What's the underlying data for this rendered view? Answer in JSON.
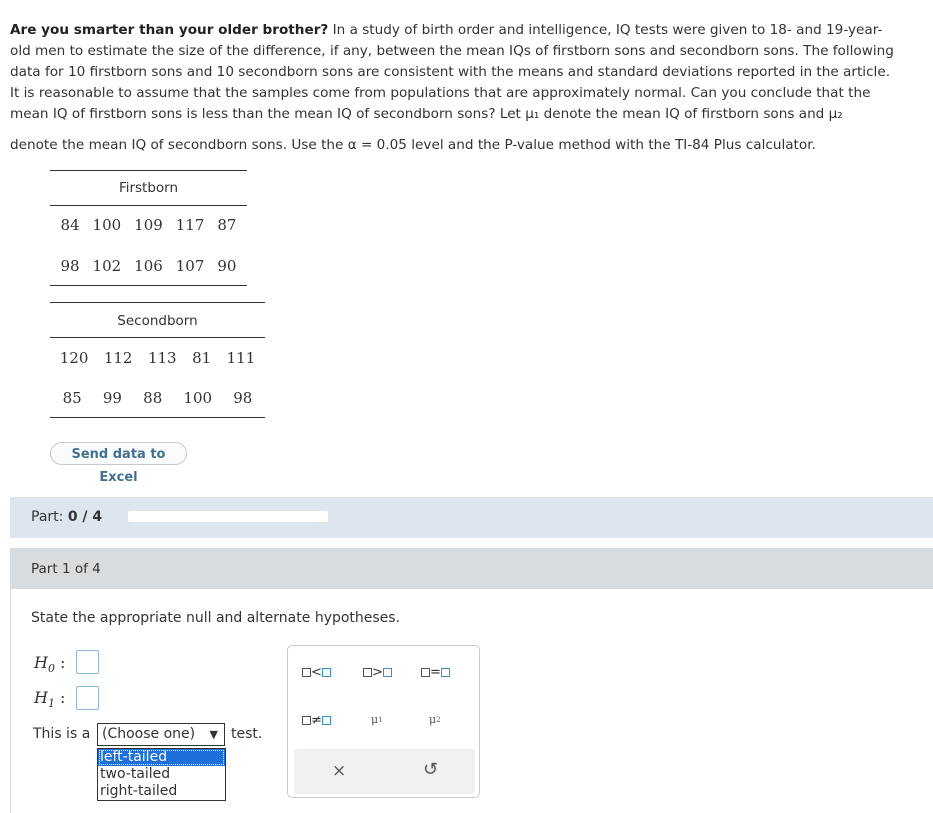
{
  "question": {
    "title": "Are you smarter than your older brother?",
    "line1_rest": " In a study of birth order and intelligence, IQ tests were given to 18- and 19-year-",
    "line2": "old men to estimate the size of the difference, if any, between the mean IQs of firstborn sons and secondborn sons. The following",
    "line3": "data for 10 firstborn sons and 10 secondborn sons are consistent with the means and standard deviations reported in the article.",
    "line4": "It is reasonable to assume that the samples come from populations that are approximately normal. Can you conclude that the",
    "line5": "mean IQ of firstborn sons is less than the mean IQ of secondborn sons? Let μ₁ denote the mean IQ of firstborn sons and μ₂",
    "line6": "denote the mean IQ of secondborn sons. Use the α = 0.05 level and the P-value method with the TI-84 Plus calculator."
  },
  "firstborn": {
    "header": "Firstborn",
    "rows": [
      [
        "84",
        "100",
        "109",
        "117",
        "87"
      ],
      [
        "98",
        "102",
        "106",
        "107",
        "90"
      ]
    ]
  },
  "secondborn": {
    "header": "Secondborn",
    "rows": [
      [
        "120",
        "112",
        "113",
        "81",
        "111"
      ],
      [
        "85",
        "99",
        "88",
        "100",
        "98"
      ]
    ]
  },
  "excel_button": "Send data to Excel",
  "part_progress": {
    "label": "Part:",
    "value": "0 / 4",
    "fraction": 0.0
  },
  "part_header": "Part 1 of 4",
  "prompt": "State the appropriate null and alternate hypotheses.",
  "h0_label": "H",
  "h0_sub": "0",
  "h1_label": "H",
  "h1_sub": "1",
  "colon": ":",
  "test_prefix": "This is a",
  "test_suffix": "test.",
  "select": {
    "value": "(Choose one)",
    "options": [
      "left-tailed",
      "two-tailed",
      "right-tailed"
    ],
    "highlighted": "left-tailed"
  },
  "palette": {
    "lt": "<",
    "gt": ">",
    "eq": "=",
    "ne": "≠",
    "mu": "μ",
    "mu1_sub": "1",
    "mu2_sub": "2",
    "clear_icon": "×",
    "undo_icon": "↺"
  }
}
